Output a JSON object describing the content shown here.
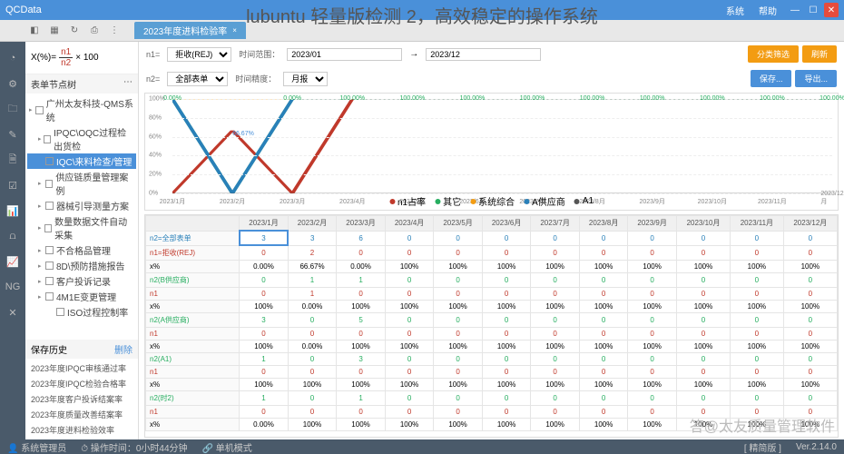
{
  "app_title": "QCData",
  "banner": "lubuntu 轻量版检测 2，高效稳定的操作系统",
  "titlebar_menu": [
    "系统",
    "帮助"
  ],
  "tab": {
    "label": "2023年度进料检验率",
    "close": "×"
  },
  "formula": {
    "prefix": "X",
    "sub": "(%)",
    "eq": "=",
    "num": "n1",
    "den": "n2",
    "suffix": "× 100"
  },
  "tree_header": "表单节点树",
  "tree": [
    {
      "l": 0,
      "exp": "▸",
      "chk": false,
      "label": "广州太友科技-QMS系统"
    },
    {
      "l": 1,
      "exp": "▸",
      "chk": false,
      "label": "IPQC\\OQC过程检出货检"
    },
    {
      "l": 1,
      "exp": "",
      "chk": true,
      "sel": true,
      "label": "IQC\\来料检查/管理"
    },
    {
      "l": 1,
      "exp": "▸",
      "chk": false,
      "label": "供应链质量管理案例"
    },
    {
      "l": 1,
      "exp": "▸",
      "chk": false,
      "label": "器械引导测量方案"
    },
    {
      "l": 1,
      "exp": "▸",
      "chk": false,
      "label": "数量数据文件自动采集"
    },
    {
      "l": 1,
      "exp": "▸",
      "chk": false,
      "label": "不合格品管理"
    },
    {
      "l": 1,
      "exp": "▸",
      "chk": false,
      "label": "8D\\预防措施报告"
    },
    {
      "l": 1,
      "exp": "▸",
      "chk": false,
      "label": "客户投诉记录"
    },
    {
      "l": 1,
      "exp": "▸",
      "chk": false,
      "label": "4M1E变更管理"
    },
    {
      "l": 2,
      "exp": "",
      "chk": false,
      "label": "ISO过程控制率"
    }
  ],
  "history_header": "保存历史",
  "history_link": "删除",
  "history": [
    "2023年度IPQC审核通过率",
    "2023年度IPQC检验合格率",
    "2023年度客户投诉结案率",
    "2023年度质量改善结案率",
    "2023年度进料检验效率"
  ],
  "filters": {
    "n1_label": "n1=",
    "n1_val": "拒收(REJ)",
    "n2_label": "n2=",
    "n2_val": "全部表单",
    "time_label": "时间范围：",
    "time_from": "2023/01",
    "time_to": "2023/12",
    "gran_label": "时间精度：",
    "gran_val": "月报"
  },
  "buttons": {
    "filter": "分类筛选",
    "refresh": "刷新",
    "save": "保存...",
    "export": "导出..."
  },
  "chart_data": {
    "type": "line",
    "categories": [
      "2023/1月",
      "2023/2月",
      "2023/3月",
      "2023/4月",
      "2023/5月",
      "2023/6月",
      "2023/7月",
      "2023/8月",
      "2023/9月",
      "2023/10月",
      "2023/11月",
      "2023/12月"
    ],
    "ylim": [
      0,
      100
    ],
    "yticks": [
      0,
      20,
      40,
      60,
      80,
      100
    ],
    "top_labels": [
      "0.00%",
      "",
      "0.00%",
      "100.00%",
      "100.00%",
      "100.00%",
      "100.00%",
      "100.00%",
      "100.00%",
      "100.00%",
      "100.00%",
      "100.00%"
    ],
    "series": [
      {
        "name": "n1占率",
        "color": "#c0392b",
        "values": [
          0,
          66.67,
          0,
          100,
          100,
          100,
          100,
          100,
          100,
          100,
          100,
          100
        ]
      },
      {
        "name": "其它",
        "color": "#27ae60",
        "values": [
          100,
          0,
          100,
          100,
          100,
          100,
          100,
          100,
          100,
          100,
          100,
          100
        ]
      },
      {
        "name": "系统综合",
        "color": "#f39c12",
        "values": [
          100,
          100,
          100,
          100,
          100,
          100,
          100,
          100,
          100,
          100,
          100,
          100
        ]
      },
      {
        "name": "A供应商",
        "color": "#2980b9",
        "values": [
          100,
          0,
          100,
          100,
          100,
          100,
          100,
          100,
          100,
          100,
          100,
          100
        ]
      },
      {
        "name": "A1",
        "color": "#555",
        "values": [
          0,
          0,
          0,
          0,
          0,
          0,
          0,
          0,
          0,
          0,
          0,
          0
        ]
      }
    ],
    "annotation": {
      "x": 1,
      "y": 66.67,
      "text": "66.67%"
    }
  },
  "table": {
    "months": [
      "2023/1月",
      "2023/2月",
      "2023/3月",
      "2023/4月",
      "2023/5月",
      "2023/6月",
      "2023/7月",
      "2023/8月",
      "2023/9月",
      "2023/10月",
      "2023/11月",
      "2023/12月"
    ],
    "rows": [
      {
        "hdr": "n2=全部表单",
        "cls": "blue",
        "sel": 0,
        "cells": [
          "3",
          "3",
          "6",
          "0",
          "0",
          "0",
          "0",
          "0",
          "0",
          "0",
          "0",
          "0"
        ]
      },
      {
        "hdr": "n1=拒收(REJ)",
        "cls": "red",
        "cells": [
          "0",
          "2",
          "0",
          "0",
          "0",
          "0",
          "0",
          "0",
          "0",
          "0",
          "0",
          "0"
        ]
      },
      {
        "hdr": "x%",
        "cls": "",
        "cells": [
          "0.00%",
          "66.67%",
          "0.00%",
          "100%",
          "100%",
          "100%",
          "100%",
          "100%",
          "100%",
          "100%",
          "100%",
          "100%"
        ]
      },
      {
        "hdr": "n2(B供应商)",
        "cls": "green",
        "cells": [
          "0",
          "1",
          "1",
          "0",
          "0",
          "0",
          "0",
          "0",
          "0",
          "0",
          "0",
          "0"
        ]
      },
      {
        "hdr": "n1",
        "cls": "red",
        "cells": [
          "0",
          "1",
          "0",
          "0",
          "0",
          "0",
          "0",
          "0",
          "0",
          "0",
          "0",
          "0"
        ]
      },
      {
        "hdr": "x%",
        "cls": "",
        "cells": [
          "100%",
          "0.00%",
          "100%",
          "100%",
          "100%",
          "100%",
          "100%",
          "100%",
          "100%",
          "100%",
          "100%",
          "100%"
        ]
      },
      {
        "hdr": "n2(A供应商)",
        "cls": "green",
        "cells": [
          "3",
          "0",
          "5",
          "0",
          "0",
          "0",
          "0",
          "0",
          "0",
          "0",
          "0",
          "0"
        ]
      },
      {
        "hdr": "n1",
        "cls": "red",
        "cells": [
          "0",
          "0",
          "0",
          "0",
          "0",
          "0",
          "0",
          "0",
          "0",
          "0",
          "0",
          "0"
        ]
      },
      {
        "hdr": "x%",
        "cls": "",
        "cells": [
          "100%",
          "0.00%",
          "100%",
          "100%",
          "100%",
          "100%",
          "100%",
          "100%",
          "100%",
          "100%",
          "100%",
          "100%"
        ]
      },
      {
        "hdr": "n2(A1)",
        "cls": "green",
        "cells": [
          "1",
          "0",
          "3",
          "0",
          "0",
          "0",
          "0",
          "0",
          "0",
          "0",
          "0",
          "0"
        ]
      },
      {
        "hdr": "n1",
        "cls": "red",
        "cells": [
          "0",
          "0",
          "0",
          "0",
          "0",
          "0",
          "0",
          "0",
          "0",
          "0",
          "0",
          "0"
        ]
      },
      {
        "hdr": "x%",
        "cls": "",
        "cells": [
          "100%",
          "100%",
          "100%",
          "100%",
          "100%",
          "100%",
          "100%",
          "100%",
          "100%",
          "100%",
          "100%",
          "100%"
        ]
      },
      {
        "hdr": "n2(时2)",
        "cls": "green",
        "cells": [
          "1",
          "0",
          "1",
          "0",
          "0",
          "0",
          "0",
          "0",
          "0",
          "0",
          "0",
          "0"
        ]
      },
      {
        "hdr": "n1",
        "cls": "red",
        "cells": [
          "0",
          "0",
          "0",
          "0",
          "0",
          "0",
          "0",
          "0",
          "0",
          "0",
          "0",
          "0"
        ]
      },
      {
        "hdr": "x%",
        "cls": "",
        "cells": [
          "0.00%",
          "100%",
          "100%",
          "100%",
          "100%",
          "100%",
          "100%",
          "100%",
          "100%",
          "100%",
          "100%",
          "100%"
        ]
      }
    ]
  },
  "statusbar": {
    "user": "系统管理员",
    "op": "操作时间：0小时44分钟",
    "mode": "单机模式",
    "edition": "[ 精简版 ]",
    "ver": "Ver.2.14.0"
  },
  "watermark": "答@太友质量管理软件"
}
